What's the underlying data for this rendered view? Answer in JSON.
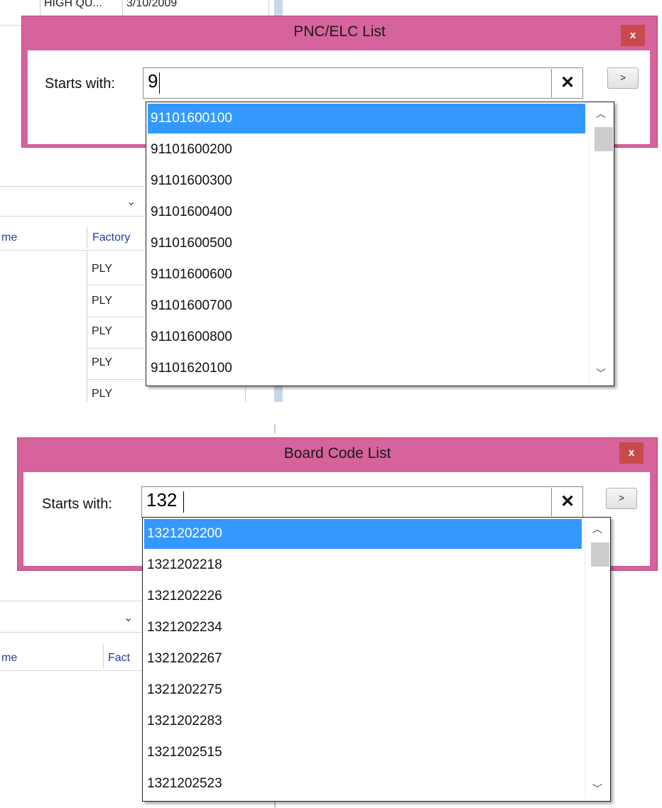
{
  "top": {
    "background": {
      "partial_row_cells": [
        "HIGH QU...",
        "3/10/2009"
      ],
      "column_headers": [
        "me",
        "Factory"
      ],
      "factory_values": [
        "PLY",
        "PLY",
        "PLY",
        "PLY",
        "PLY"
      ]
    },
    "dialog": {
      "title": "PNC/ELC List",
      "close_label": "x",
      "starts_with_label": "Starts with:",
      "search_value": "9",
      "clear_label": "✕",
      "go_label": ">",
      "items": [
        "91101600100",
        "91101600200",
        "91101600300",
        "91101600400",
        "91101600500",
        "91101600600",
        "91101600700",
        "91101600800",
        "91101620100"
      ],
      "selected_index": 0
    }
  },
  "bottom": {
    "background": {
      "column_headers": [
        "me",
        "Fact"
      ]
    },
    "dialog": {
      "title": "Board Code List",
      "close_label": "x",
      "starts_with_label": "Starts with:",
      "search_value": "132",
      "clear_label": "✕",
      "go_label": ">",
      "items": [
        "1321202200",
        "1321202218",
        "1321202226",
        "1321202234",
        "1321202267",
        "1321202275",
        "1321202283",
        "1321202515",
        "1321202523"
      ],
      "selected_index": 0
    }
  },
  "colors": {
    "dialog_frame": "#d6639b",
    "close_button": "#c94a4a",
    "selection": "#3399ff",
    "header_text": "#1f3f9f"
  }
}
